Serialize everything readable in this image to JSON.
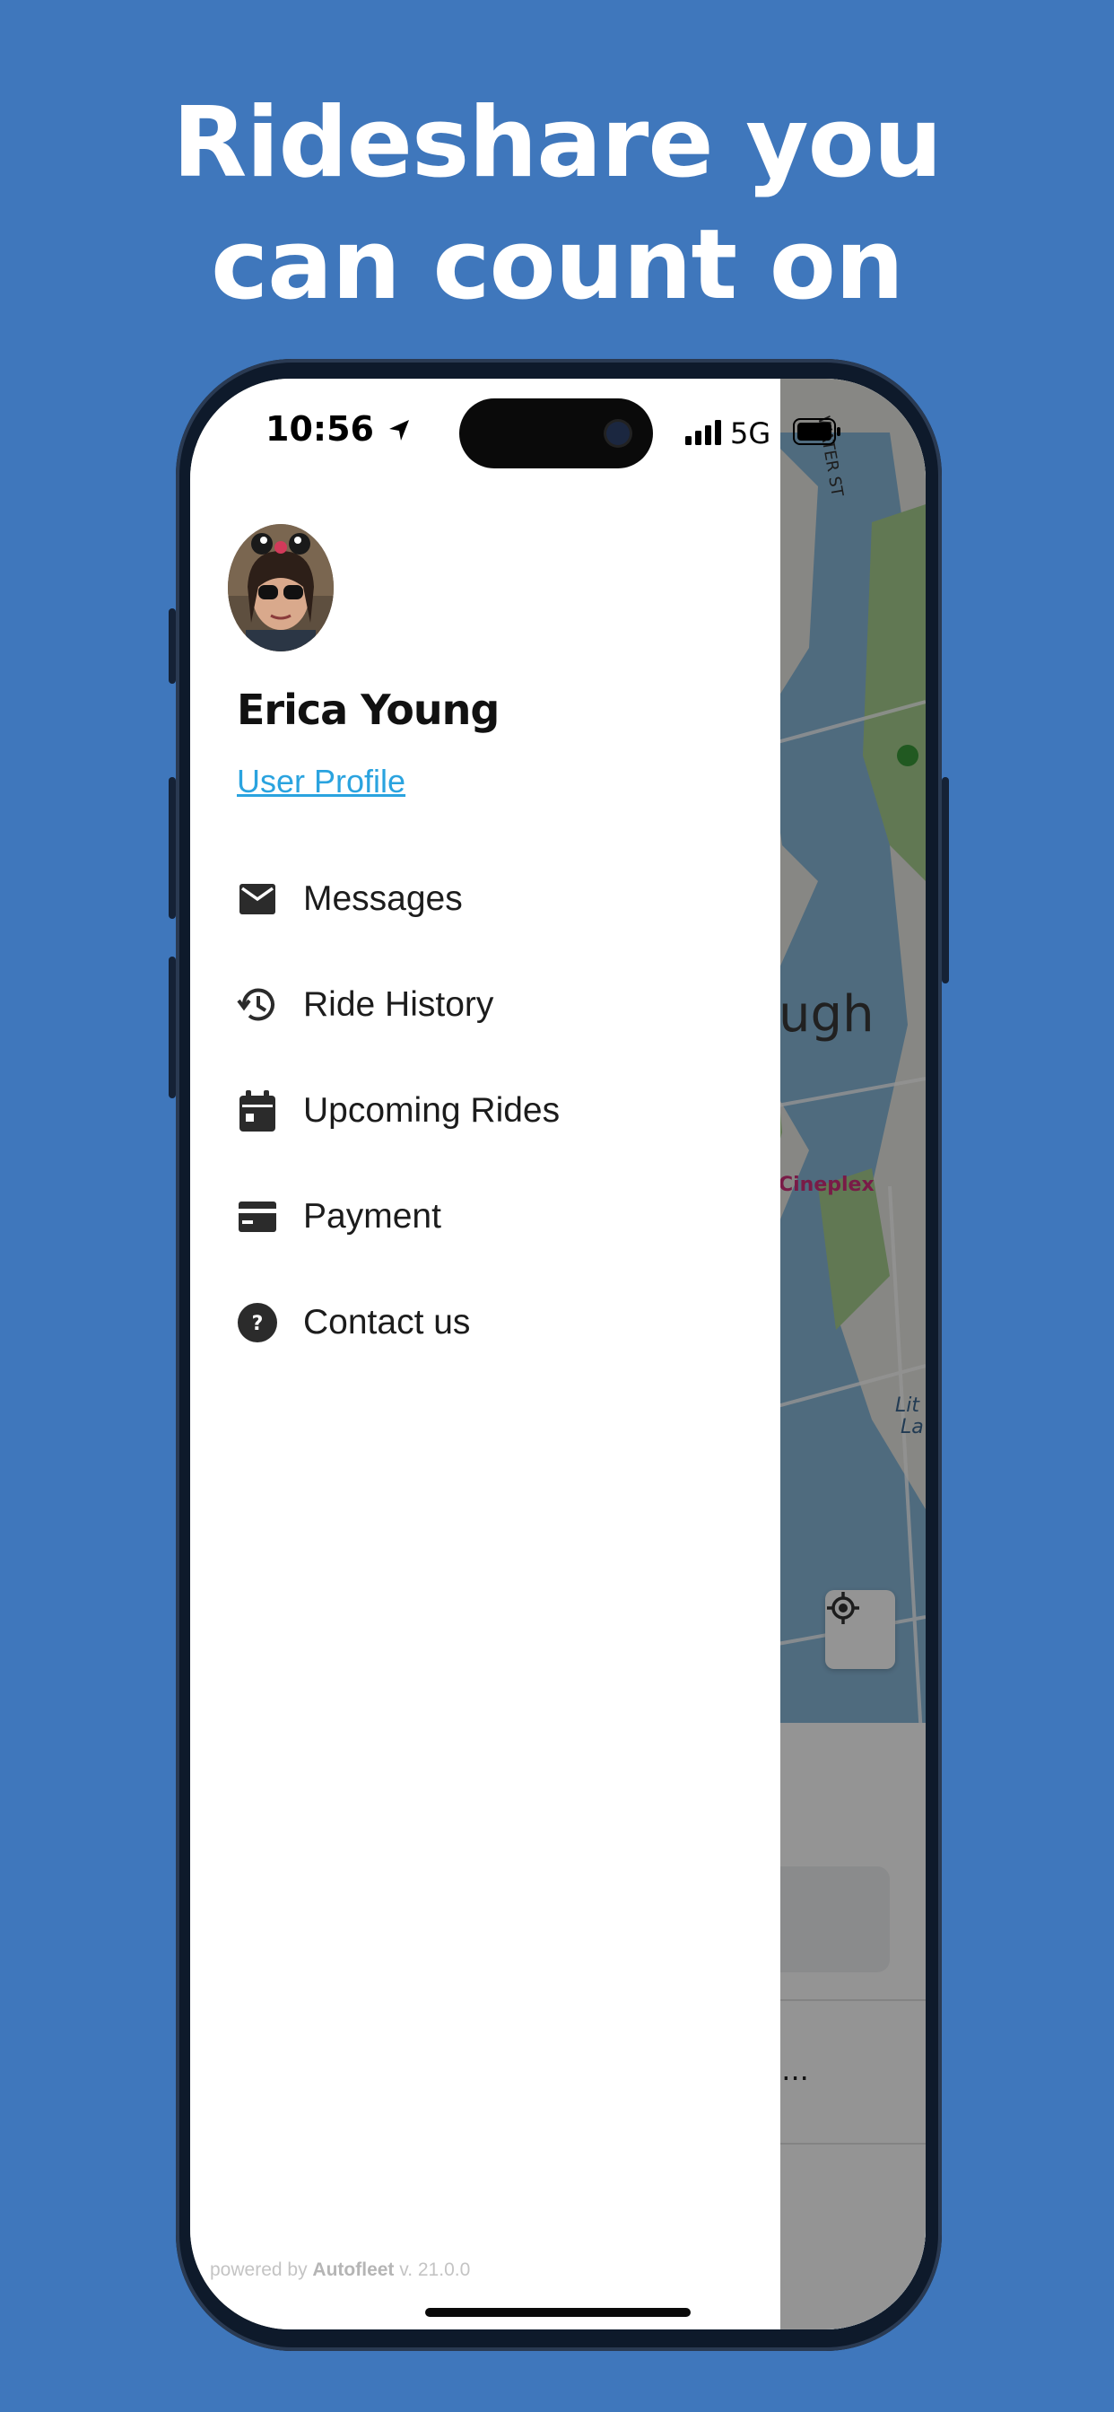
{
  "headline": {
    "line1": "Rideshare you",
    "line2": "can count on"
  },
  "status_bar": {
    "time": "10:56",
    "network": "5G",
    "location_icon": "location-arrow-icon",
    "signal_icon": "signal-bars-icon",
    "battery_icon": "battery-icon"
  },
  "user": {
    "name": "Erica Young",
    "profile_link": "User Profile",
    "avatar": "user-avatar-photo"
  },
  "menu": [
    {
      "label": "Messages",
      "icon": "envelope-icon"
    },
    {
      "label": "Ride History",
      "icon": "history-clock-icon"
    },
    {
      "label": "Upcoming Rides",
      "icon": "calendar-icon"
    },
    {
      "label": "Payment",
      "icon": "credit-card-icon"
    },
    {
      "label": "Contact us",
      "icon": "help-circle-icon"
    }
  ],
  "map": {
    "street_label": "WATER ST",
    "area_label": "rough",
    "poi_label": "Cineplex",
    "lake_label_1": "Lit",
    "lake_label_2": "La",
    "locate_icon": "crosshair-locate-icon"
  },
  "bottom_sheet": {
    "address_snippet": "ON,..."
  },
  "footer": {
    "prefix": "powered by",
    "brand": "Autofleet",
    "version": "v. 21.0.0"
  },
  "colors": {
    "background": "#3f77bc",
    "link": "#2aa3df",
    "drawer": "#ffffff",
    "icon": "#2b2b2b"
  }
}
